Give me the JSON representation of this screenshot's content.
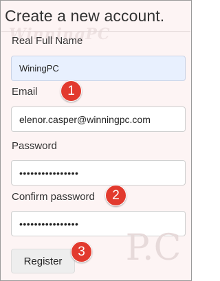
{
  "form": {
    "title": "Create a new account.",
    "watermark": "WinningPC",
    "fields": [
      {
        "label": "Real Full Name",
        "value": "WiningPC"
      },
      {
        "label": "Email",
        "value": "elenor.casper@winningpc.com"
      },
      {
        "label": "Password",
        "value": "••••••••••••••••"
      },
      {
        "label": "Confirm password",
        "value": "••••••••••••••••"
      }
    ],
    "register_label": "Register"
  },
  "badges": [
    "1",
    "2",
    "3"
  ],
  "watermark_pc": "P.C",
  "colors": {
    "badge": "#e23a2e",
    "background": "#fdf4f4",
    "autofill": "#e8f0fe"
  }
}
